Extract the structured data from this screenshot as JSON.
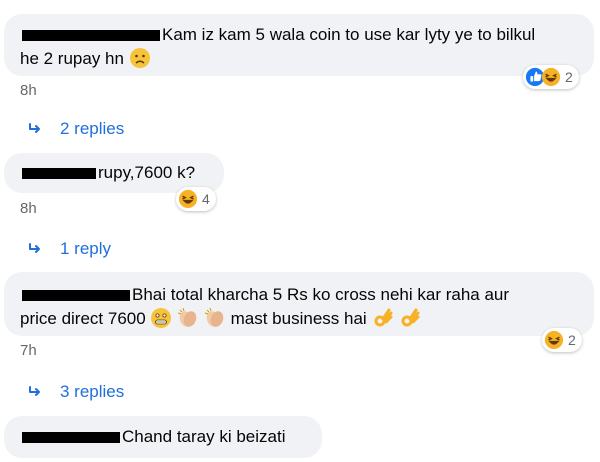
{
  "comments": [
    {
      "text_line1": "Kam iz kam 5 wala coin to use kar lyty ye to bilkul",
      "text_line2": "he 2 rupay hn",
      "time": "8h",
      "reaction_count": "2",
      "replies_label": "2 replies"
    },
    {
      "text": "rupy,7600 k?",
      "time": "8h",
      "reaction_count": "4",
      "replies_label": "1 reply"
    },
    {
      "text_line1": "Bhai total kharcha 5 Rs ko cross nehi kar raha aur",
      "text_line2a": "price direct 7600",
      "text_line2b": "mast business hai",
      "time": "7h",
      "reaction_count": "2",
      "replies_label": "3 replies"
    },
    {
      "text": "Chand taray ki beizati"
    }
  ],
  "colors": {
    "bubble": "#f0f2f5",
    "link": "#216fdb",
    "meta": "#65676b",
    "like": "#1877f2",
    "haha": "#f7b125"
  },
  "icons": [
    "reply-arrow-icon",
    "like-reaction-icon",
    "haha-reaction-icon",
    "worried-emoji-icon",
    "grimacing-emoji-icon",
    "clap-emoji-icon",
    "ok-hand-emoji-icon"
  ]
}
